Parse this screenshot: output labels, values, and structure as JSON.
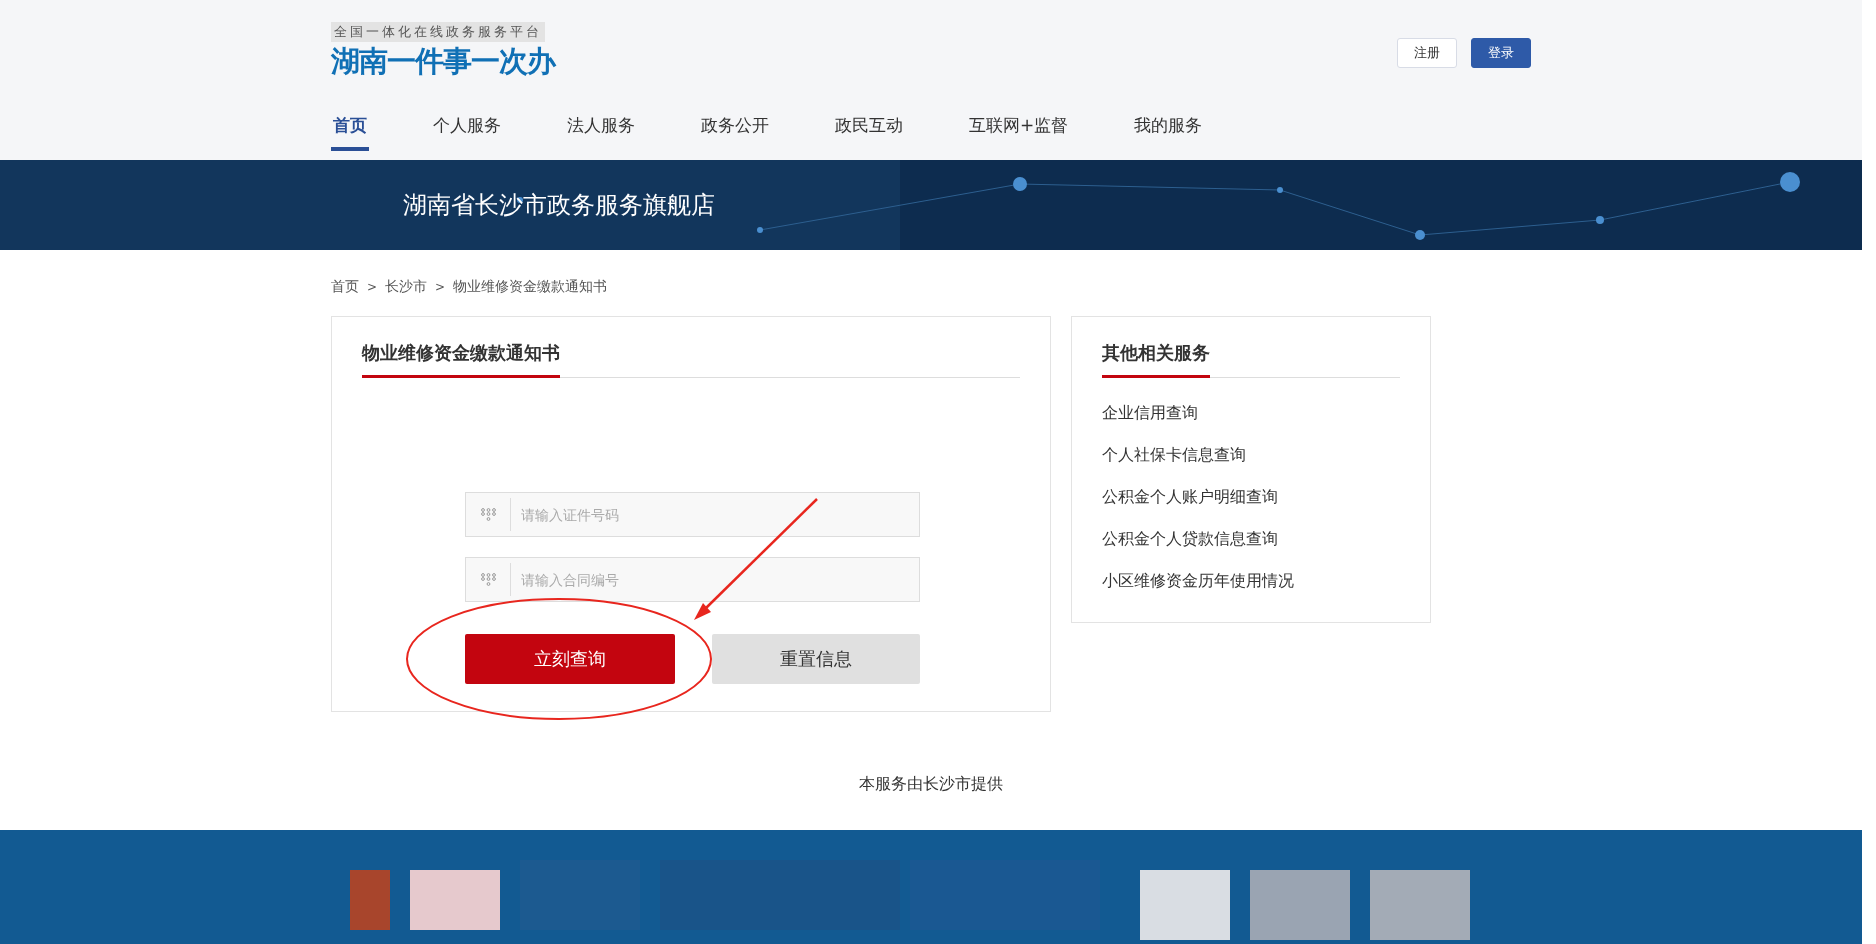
{
  "header": {
    "platform": "全国一体化在线政务服务平台",
    "logo": "湖南一件事一次办",
    "register": "注册",
    "login": "登录"
  },
  "nav": [
    {
      "label": "首页",
      "selected": true
    },
    {
      "label": "个人服务",
      "selected": false
    },
    {
      "label": "法人服务",
      "selected": false
    },
    {
      "label": "政务公开",
      "selected": false
    },
    {
      "label": "政民互动",
      "selected": false
    },
    {
      "label": "互联网+监督",
      "selected": false
    },
    {
      "label": "我的服务",
      "selected": false
    }
  ],
  "banner": {
    "title": "湖南省长沙市政务服务旗舰店"
  },
  "breadcrumb": [
    "首页",
    "长沙市",
    "物业维修资金缴款通知书"
  ],
  "breadcrumb_separator": ">",
  "form": {
    "title": "物业维修资金缴款通知书",
    "fields": [
      {
        "placeholder": "请输入证件号码"
      },
      {
        "placeholder": "请输入合同编号"
      }
    ],
    "submit": "立刻查询",
    "reset": "重置信息"
  },
  "related": {
    "title": "其他相关服务",
    "links": [
      "企业信用查询",
      "个人社保卡信息查询",
      "公积金个人账户明细查询",
      "公积金个人贷款信息查询",
      "小区维修资金历年使用情况"
    ]
  },
  "provider": "本服务由长沙市提供"
}
